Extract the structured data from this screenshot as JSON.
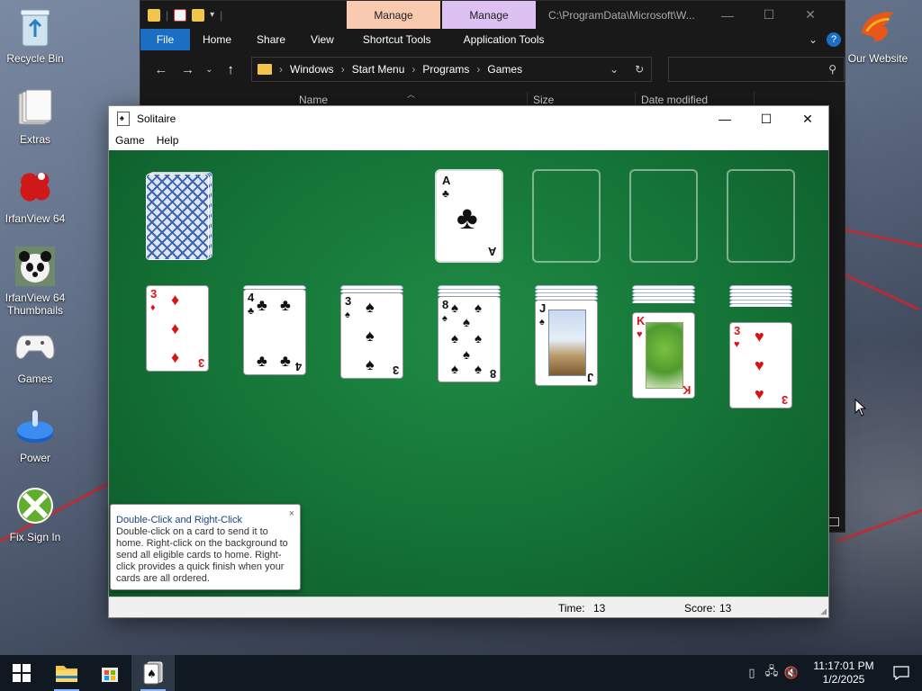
{
  "desktop": {
    "icons": [
      {
        "label": "Recycle Bin"
      },
      {
        "label": "Extras"
      },
      {
        "label": "IrfanView 64"
      },
      {
        "label": "IrfanView 64 Thumbnails"
      },
      {
        "label": "Games"
      },
      {
        "label": "Power"
      },
      {
        "label": "Fix Sign In"
      },
      {
        "label": "Our Website"
      }
    ]
  },
  "explorer": {
    "context_tab_1": "Manage",
    "context_tab_2": "Manage",
    "path_title": "C:\\ProgramData\\Microsoft\\W...",
    "ribbon": [
      "File",
      "Home",
      "Share",
      "View",
      "Shortcut Tools",
      "Application Tools"
    ],
    "breadcrumb": [
      "Windows",
      "Start Menu",
      "Programs",
      "Games"
    ],
    "columns": [
      "Name",
      "Size",
      "Date modified"
    ],
    "colors": {
      "manage_1": "#f9c9b0",
      "manage_2": "#dcc1f2",
      "file_tab": "#1a6fc2"
    }
  },
  "solitaire": {
    "title": "Solitaire",
    "menu": [
      "Game",
      "Help"
    ],
    "foundation_card": {
      "rank": "A",
      "suit": "♣"
    },
    "tableau": [
      {
        "rank": "3",
        "suit": "♦",
        "color": "red"
      },
      {
        "rank": "4",
        "suit": "♣",
        "color": "blk"
      },
      {
        "rank": "3",
        "suit": "♠",
        "color": "blk"
      },
      {
        "rank": "8",
        "suit": "♠",
        "color": "blk"
      },
      {
        "rank": "J",
        "suit": "♠",
        "color": "blk"
      },
      {
        "rank": "K",
        "suit": "♥",
        "color": "red"
      },
      {
        "rank": "3",
        "suit": "♥",
        "color": "red"
      }
    ],
    "status": {
      "time_label": "Time:",
      "time_value": "13",
      "score_label": "Score:",
      "score_value": "13"
    },
    "tip": {
      "title": "Double-Click and Right-Click",
      "body": "Double-click on a card to send it to home. Right-click on the background to send all eligible cards to home. Right-click provides a quick finish when your cards are all ordered.",
      "close": "×"
    }
  },
  "taskbar": {
    "clock_time": "11:17:01 PM",
    "clock_date": "1/2/2025"
  }
}
